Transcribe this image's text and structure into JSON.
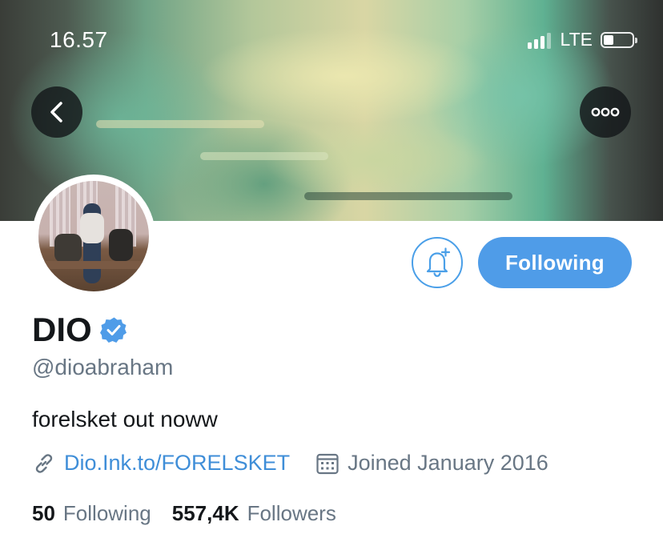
{
  "status_bar": {
    "time": "16.57",
    "network": "LTE"
  },
  "header": {
    "back_icon": "chevron-left-icon",
    "more_icon": "more-horizontal-icon"
  },
  "profile": {
    "display_name": "DIO",
    "verified": true,
    "handle": "@dioabraham",
    "bio": "forelsket out noww",
    "link": "Dio.Ink.to/FORELSKET",
    "joined": "Joined January 2016",
    "following_count": "50",
    "following_label": "Following",
    "followers_count": "557,4K",
    "followers_label": "Followers"
  },
  "actions": {
    "notify_icon": "bell-plus-icon",
    "follow_state_label": "Following"
  },
  "colors": {
    "accent": "#4f9ce8",
    "link": "#3f8ed8",
    "muted": "#687684",
    "text": "#14171a"
  }
}
